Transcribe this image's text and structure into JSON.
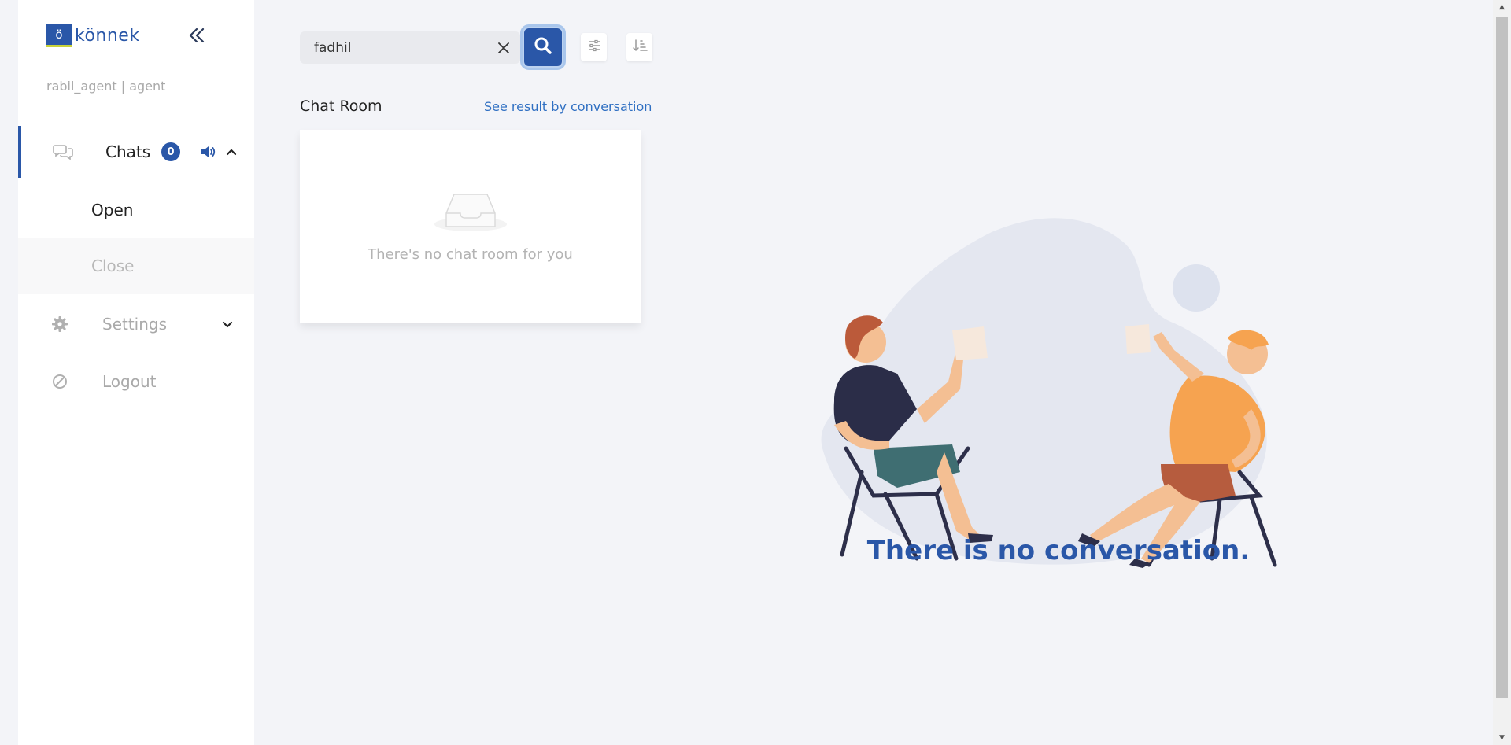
{
  "brand": {
    "logo_letter": "ö",
    "name": "könnek"
  },
  "user": {
    "line": "rabil_agent | agent"
  },
  "nav": {
    "chats_label": "Chats",
    "chats_count": "0",
    "open_label": "Open",
    "close_label": "Close",
    "settings_label": "Settings",
    "logout_label": "Logout"
  },
  "search": {
    "value": "fadhil",
    "placeholder": ""
  },
  "results": {
    "section_title": "Chat Room",
    "see_result_link": "See result by conversation",
    "empty_message": "There's no chat room for you"
  },
  "main": {
    "empty_conversation": "There is no conversation."
  },
  "colors": {
    "brand": "#2a57a8",
    "link": "#2f6fc2",
    "muted": "#a9a9a9",
    "background": "#f3f4f8"
  }
}
